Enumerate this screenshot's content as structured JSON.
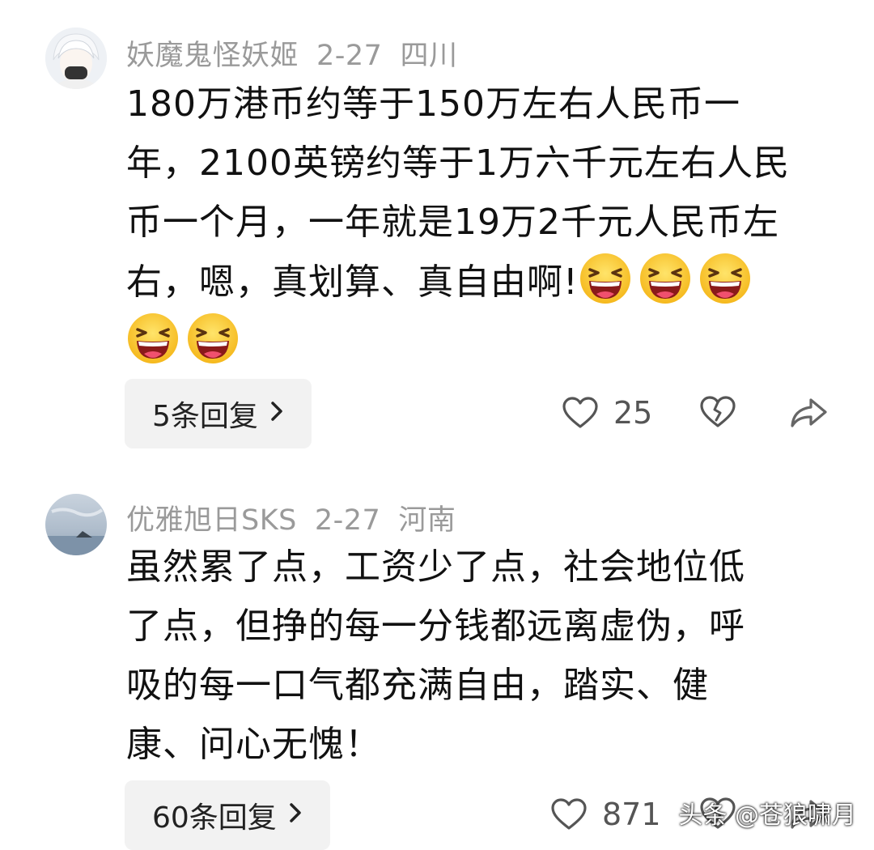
{
  "comments": [
    {
      "username": "妖魔鬼怪妖姬",
      "date": "2-27",
      "location": "四川",
      "lines": [
        "180万港币约等于150万左右人民币一",
        "年，2100英镑约等于1万六千元左右人民",
        "币一个月，一年就是19万2千元人民币左",
        "右，嗯，真划算、真自由啊!"
      ],
      "emoji_icon": "laughing-face-emoji",
      "emoji_count": 5,
      "replies_label": "5条回复",
      "likes": "25"
    },
    {
      "username": "优雅旭日SKS",
      "date": "2-27",
      "location": "河南",
      "lines": [
        "虽然累了点，工资少了点，社会地位低",
        "了点，但挣的每一分钱都远离虚伪，呼",
        "吸的每一口气都充满自由，踏实、健",
        "康、问心无愧！"
      ],
      "replies_label": "60条回复",
      "likes": "871"
    }
  ],
  "watermark": "头条 @苍狼啸月",
  "colors": {
    "meta_gray": "#9a9a9a",
    "button_bg": "#f2f2f2",
    "icon_gray": "#555555"
  }
}
